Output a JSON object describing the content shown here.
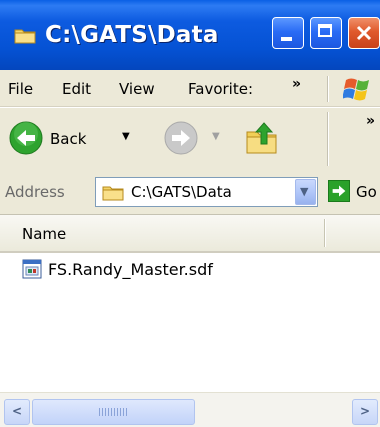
{
  "window": {
    "title": "C:\\GATS\\Data"
  },
  "menubar": {
    "items": [
      "File",
      "Edit",
      "View",
      "Favorite:"
    ],
    "overflow": "»"
  },
  "toolbar": {
    "back_label": "Back",
    "back_dropdown": "▼",
    "forward_dropdown": "▼",
    "overflow": "»"
  },
  "addressbar": {
    "label": "Address",
    "value": "C:\\GATS\\Data",
    "go_label": "Go"
  },
  "listview": {
    "columns": [
      "Name"
    ],
    "files": [
      {
        "name": "FS.Randy_Master.sdf",
        "icon": "sdf-file-icon"
      }
    ]
  },
  "colors": {
    "titlebar": "#0552d4",
    "close_button": "#e05a2c",
    "chrome": "#ece9d8"
  }
}
